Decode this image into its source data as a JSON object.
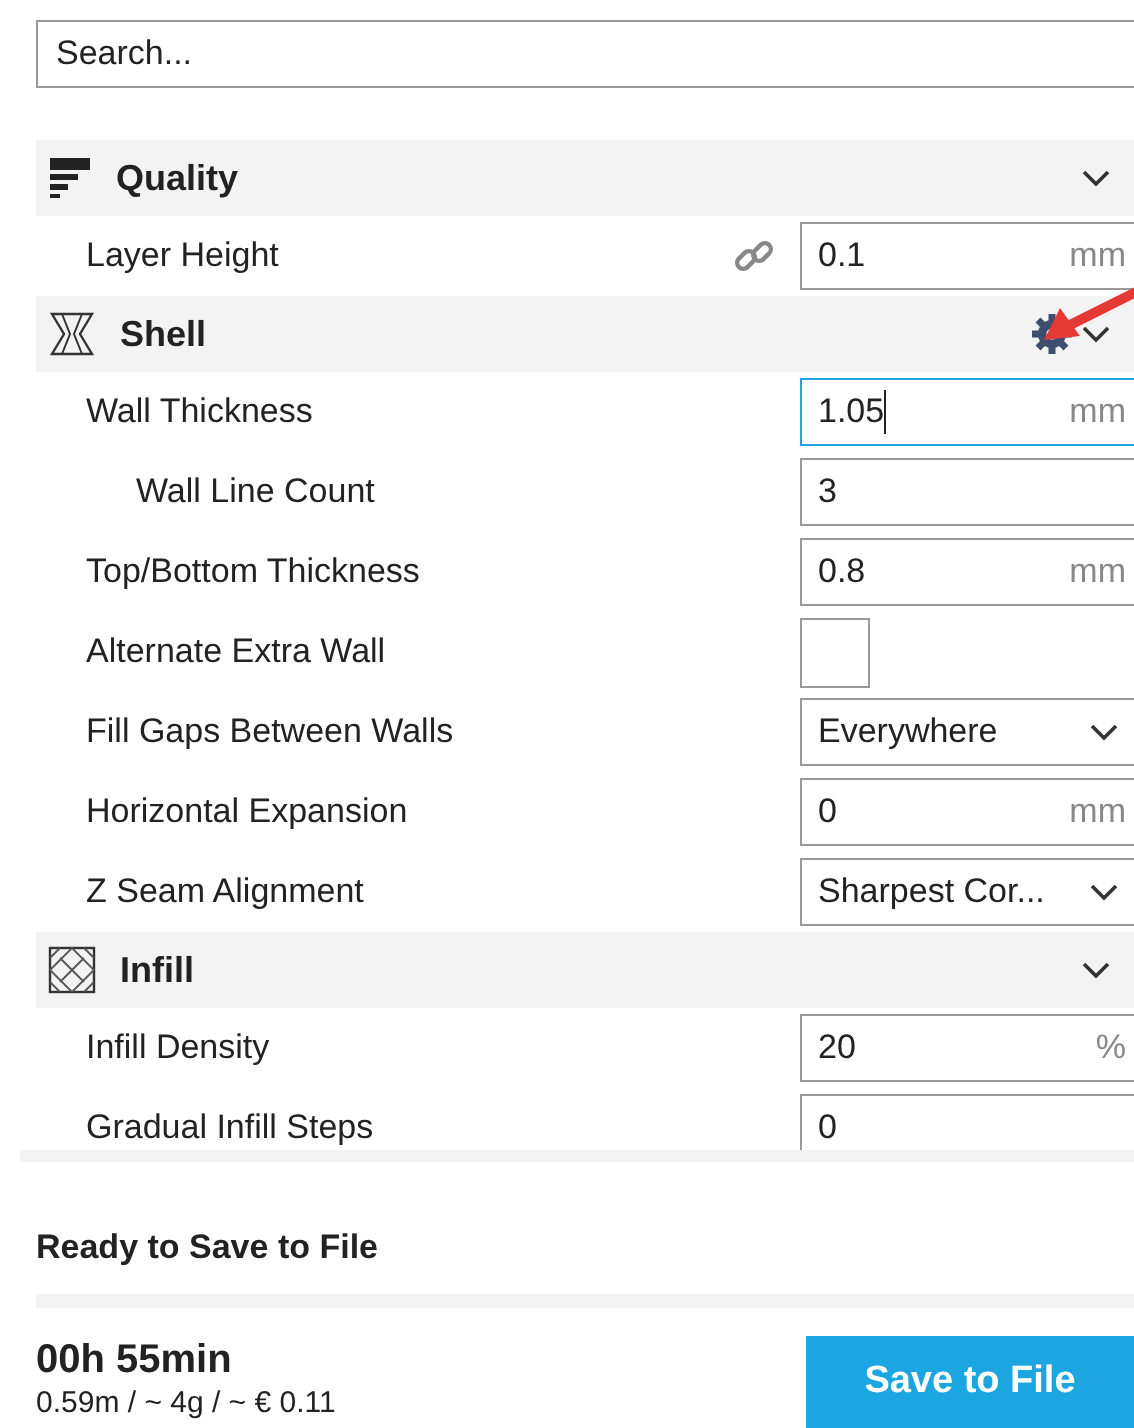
{
  "search": {
    "placeholder": "Search..."
  },
  "categories": [
    {
      "title": "Quality",
      "expanded": true,
      "gear": false,
      "settings": [
        {
          "label": "Layer Height",
          "kind": "number",
          "value": "0.1",
          "unit": "mm",
          "linked": true,
          "focused": false
        }
      ]
    },
    {
      "title": "Shell",
      "expanded": true,
      "gear": true,
      "settings": [
        {
          "label": "Wall Thickness",
          "kind": "number",
          "value": "1.05",
          "unit": "mm",
          "linked": false,
          "focused": true,
          "children": [
            {
              "label": "Wall Line Count",
              "kind": "number",
              "value": "3",
              "linked": false,
              "focused": false
            }
          ]
        },
        {
          "label": "Top/Bottom Thickness",
          "kind": "number",
          "value": "0.8",
          "unit": "mm",
          "linked": false,
          "focused": false
        },
        {
          "label": "Alternate Extra Wall",
          "kind": "checkbox",
          "checked": false
        },
        {
          "label": "Fill Gaps Between Walls",
          "kind": "select",
          "value": "Everywhere"
        },
        {
          "label": "Horizontal Expansion",
          "kind": "number",
          "value": "0",
          "unit": "mm",
          "linked": false,
          "focused": false
        },
        {
          "label": "Z Seam Alignment",
          "kind": "select",
          "value": "Sharpest Cor..."
        }
      ]
    },
    {
      "title": "Infill",
      "expanded": true,
      "gear": false,
      "settings": [
        {
          "label": "Infill Density",
          "kind": "number",
          "value": "20",
          "unit": "%",
          "linked": false,
          "focused": false
        },
        {
          "label": "Gradual Infill Steps",
          "kind": "number",
          "value": "0",
          "linked": false,
          "focused": false
        }
      ]
    }
  ],
  "footer": {
    "status": "Ready to Save to File",
    "progress": {
      "level": 0
    },
    "time": "00h 55min",
    "estimate": "0.59m / ~ 4g / ~ € 0.11",
    "button": "Save to File"
  }
}
